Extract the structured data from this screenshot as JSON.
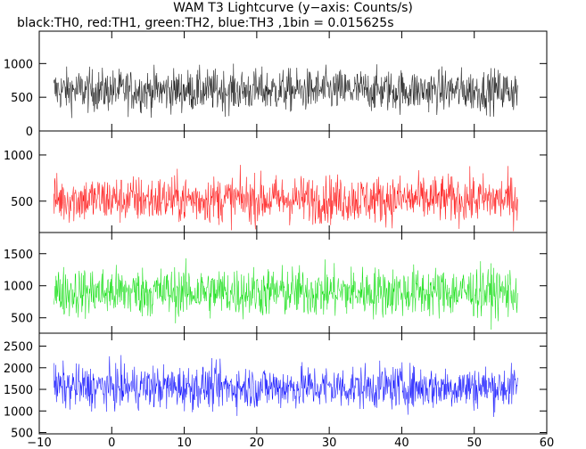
{
  "chart_data": {
    "type": "line",
    "title": "WAM T3 Lightcurve (y−axis: Counts/s)",
    "subtitle": "black:TH0, red:TH1, green:TH2, blue:TH3 ,1bin = 0.015625s",
    "x_ticks": [
      -10,
      0,
      10,
      20,
      30,
      40,
      50,
      60
    ],
    "xlim": [
      -10,
      60
    ],
    "data_xrange": [
      -8,
      56
    ],
    "grid": false,
    "panels": [
      {
        "name": "TH0",
        "color": "#000000",
        "ylim": [
          0,
          1480
        ],
        "y_ticks": [
          0,
          500,
          1000
        ],
        "mean": 600,
        "spread": 280
      },
      {
        "name": "TH1",
        "color": "#ff0000",
        "ylim": [
          160,
          1260
        ],
        "y_ticks": [
          500,
          1000
        ],
        "mean": 520,
        "spread": 230
      },
      {
        "name": "TH2",
        "color": "#00dd00",
        "ylim": [
          260,
          1830
        ],
        "y_ticks": [
          500,
          1000,
          1500
        ],
        "mean": 900,
        "spread": 350
      },
      {
        "name": "TH3",
        "color": "#0000ff",
        "ylim": [
          470,
          2800
        ],
        "y_ticks": [
          500,
          1000,
          1500,
          2000,
          2500
        ],
        "mean": 1550,
        "spread": 450
      }
    ]
  }
}
